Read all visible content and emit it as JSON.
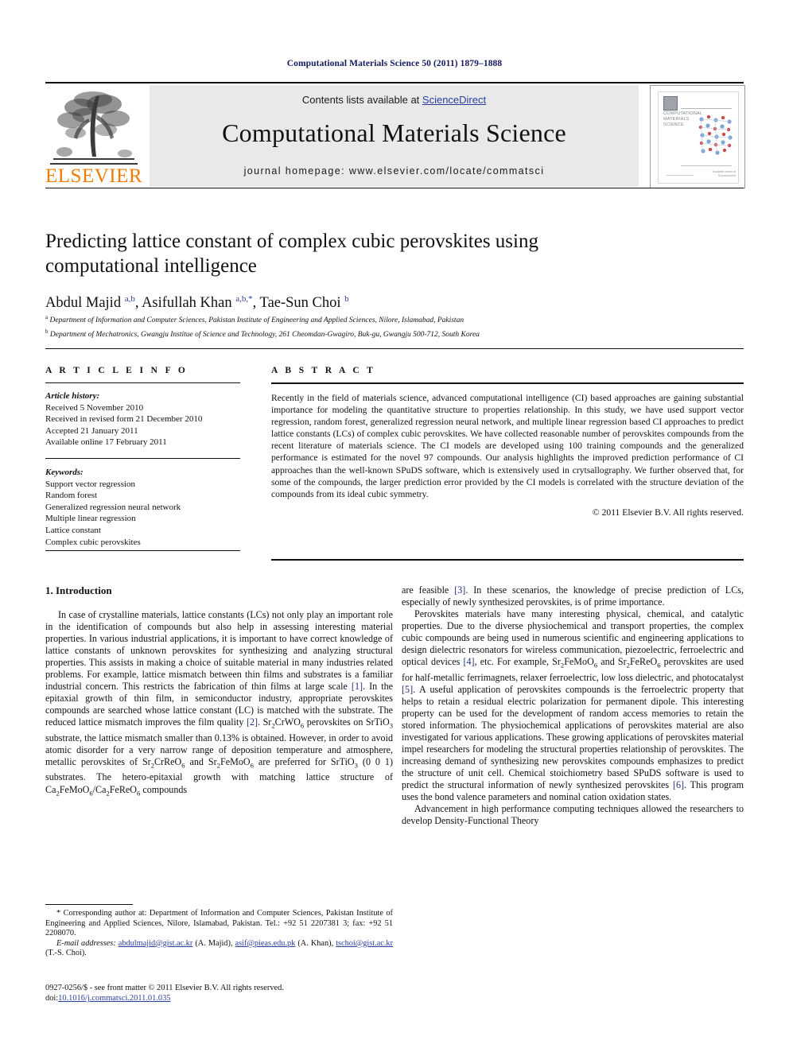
{
  "running_head": "Computational Materials Science 50 (2011) 1879–1888",
  "masthead": {
    "contents_prefix": "Contents lists available at ",
    "sciencedirect": "ScienceDirect",
    "journal_title": "Computational Materials Science",
    "homepage": "journal homepage: www.elsevier.com/locate/commatsci",
    "publisher_name": "ELSEVIER",
    "cover_title_lines": "COMPUTATIONAL MATERIALS SCIENCE",
    "cover_footer": "Available online at ScienceDirect"
  },
  "article": {
    "title": "Predicting lattice constant of complex cubic perovskites using computational intelligence",
    "authors_html": "Abdul Majid <sup>a,b</sup>, Asifullah Khan <sup>a,b,*</sup>, Tae-Sun Choi <sup>b</sup>",
    "affiliation_a": "Department of Information and Computer Sciences, Pakistan Institute of Engineering and Applied Sciences, Nilore, Islamabad, Pakistan",
    "affiliation_b": "Department of Mechatronics, Gwangju Institue of Science and Technology, 261 Cheomdan-Gwagiro, Buk-gu, Gwangju 500-712, South Korea"
  },
  "article_info": {
    "heading": "A R T I C L E  I N F O",
    "history_label": "Article history:",
    "history": [
      "Received 5 November 2010",
      "Received in revised form 21 December 2010",
      "Accepted 21 January 2011",
      "Available online 17 February 2011"
    ],
    "keywords_label": "Keywords:",
    "keywords": [
      "Support vector regression",
      "Random forest",
      "Generalized regression neural network",
      "Multiple linear regression",
      "Lattice constant",
      "Complex cubic perovskites"
    ]
  },
  "abstract": {
    "heading": "A B S T R A C T",
    "text": "Recently in the field of materials science, advanced computational intelligence (CI) based approaches are gaining substantial importance for modeling the quantitative structure to properties relationship. In this study, we have used support vector regression, random forest, generalized regression neural network, and multiple linear regression based CI approaches to predict lattice constants (LCs) of complex cubic perovskites. We have collected reasonable number of perovskites compounds from the recent literature of materials science. The CI models are developed using 100 training compounds and the generalized performance is estimated for the novel 97 compounds. Our analysis highlights the improved prediction performance of CI approaches than the well-known SPuDS software, which is extensively used in crytsallography. We further observed that, for some of the compounds, the larger prediction error provided by the CI models is correlated with the structure deviation of the compounds from its ideal cubic symmetry.",
    "copyright": "© 2011 Elsevier B.V. All rights reserved."
  },
  "body": {
    "section_heading": "1. Introduction",
    "left_paragraphs": [
      "In case of crystalline materials, lattice constants (LCs) not only play an important role in the identification of compounds but also help in assessing interesting material properties. In various industrial applications, it is important to have correct knowledge of lattice constants of unknown perovskites for synthesizing and analyzing structural properties. This assists in making a choice of suitable material in many industries related problems. For example, lattice mismatch between thin films and substrates is a familiar industrial concern. This restricts the fabrication of thin films at large scale [1]. In the epitaxial growth of thin film, in semiconductor industry, appropriate perovskites compounds are searched whose lattice constant (LC) is matched with the substrate. The reduced lattice mismatch improves the film quality [2]. Sr2CrWO6 perovskites on SrTiO3 substrate, the lattice mismatch smaller than 0.13% is obtained. However, in order to avoid atomic disorder for a very narrow range of deposition temperature and atmosphere, metallic perovskites of Sr2CrReO6 and Sr2FeMoO6 are preferred for SrTiO3 (0 0 1) substrates. The hetero-epitaxial growth with matching lattice structure of Ca2FeMoO6/Ca2FeReO6 compounds"
    ],
    "right_paragraphs": [
      "are feasible [3]. In these scenarios, the knowledge of precise prediction of LCs, especially of newly synthesized perovskites, is of prime importance.",
      "Perovskites materials have many interesting physical, chemical, and catalytic properties. Due to the diverse physiochemical and transport properties, the complex cubic compounds are being used in numerous scientific and engineering applications to design dielectric resonators for wireless communication, piezoelectric, ferroelectric and optical devices [4], etc. For example, Sr2FeMoO6 and Sr2FeReO6 perovskites are used for half-metallic ferrimagnets, relaxer ferroelectric, low loss dielectric, and photocatalyst [5]. A useful application of perovskites compounds is the ferroelectric property that helps to retain a residual electric polarization for permanent dipole. This interesting property can be used for the development of random access memories to retain the stored information. The physiochemical applications of perovskites material are also investigated for various applications. These growing applications of perovskites material impel researchers for modeling the structural properties relationship of perovskites. The increasing demand of synthesizing new perovskites compounds emphasizes to predict the structure of unit cell. Chemical stoichiometry based SPuDS software is used to predict the structural information of newly synthesized perovskites [6]. This program uses the bond valence parameters and nominal cation oxidation states.",
      "Advancement in high performance computing techniques allowed the researchers to develop Density-Functional Theory"
    ]
  },
  "footnotes": {
    "corresponding": "* Corresponding author at: Department of Information and Computer Sciences, Pakistan Institute of Engineering and Applied Sciences, Nilore, Islamabad, Pakistan. Tel.: +92 51 2207381 3; fax: +92 51 2208070.",
    "email_label": "E-mail addresses:",
    "email1": "abdulmajid@gist.ac.kr",
    "email1_who": " (A. Majid), ",
    "email2": "asif@pieas.edu.pk",
    "email2_who": " (A. Khan), ",
    "email3": "tschoi@gist.ac.kr",
    "email3_who": " (T.-S. Choi)."
  },
  "imprint": {
    "issn_line": "0927-0256/$ - see front matter © 2011 Elsevier B.V. All rights reserved.",
    "doi_label": "doi:",
    "doi_value": "10.1016/j.commatsci.2011.01.035"
  },
  "colors": {
    "running_head": "#15195e",
    "link": "#2b3e9e",
    "elsevier_orange": "#f07c00",
    "band_gray": "#e9e9e9"
  }
}
